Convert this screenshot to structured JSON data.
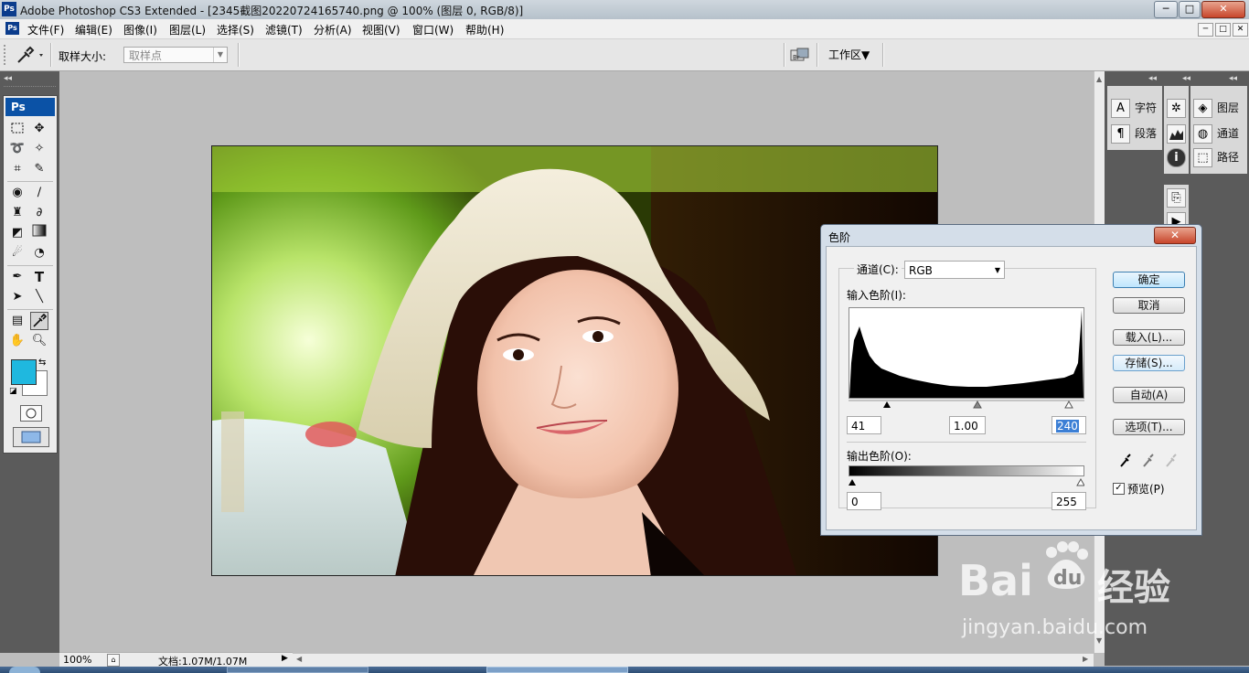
{
  "window": {
    "app_icon": "Ps",
    "title": "Adobe Photoshop CS3 Extended - [2345截图20220724165740.png @ 100% (图层 0, RGB/8)]",
    "controls": [
      "─",
      "□",
      "✕"
    ]
  },
  "menubar": {
    "items": [
      "文件(F)",
      "编辑(E)",
      "图像(I)",
      "图层(L)",
      "选择(S)",
      "滤镜(T)",
      "分析(A)",
      "视图(V)",
      "窗口(W)",
      "帮助(H)"
    ],
    "doc_controls": [
      "─",
      "□",
      "✕"
    ]
  },
  "options_bar": {
    "tool_icon": "eyedropper-icon",
    "sample_size_label": "取样大小:",
    "sample_size_value": "取样点",
    "workspace_label": "工作区▼"
  },
  "toolbox": {
    "header": "Ps",
    "tools": [
      "marquee",
      "move",
      "lasso",
      "magic-wand",
      "crop",
      "slice",
      "healing",
      "brush",
      "stamp",
      "history-brush",
      "eraser",
      "gradient",
      "blur",
      "dodge",
      "pen",
      "type",
      "path-select",
      "line",
      "notes",
      "eyedropper",
      "hand",
      "zoom"
    ],
    "foreground_color": "#1fb8df",
    "background_color": "#ffffff"
  },
  "status_bar": {
    "zoom": "100%",
    "doc_info": "文档:1.07M/1.07M"
  },
  "panels": {
    "group1": [
      {
        "icon": "A",
        "label": "字符"
      },
      {
        "icon": "¶",
        "label": "段落"
      }
    ],
    "group2": [
      {
        "icon": "navigator-icon"
      },
      {
        "icon": "histogram-icon"
      },
      {
        "icon": "info-icon"
      }
    ],
    "group3": [
      {
        "icon": "layers-icon",
        "label": "图层"
      },
      {
        "icon": "channels-icon",
        "label": "通道"
      },
      {
        "icon": "paths-icon",
        "label": "路径"
      }
    ]
  },
  "levels_dialog": {
    "title": "色阶",
    "close": "✕",
    "channel_label": "通道(C):",
    "channel_value": "RGB",
    "input_label": "输入色阶(I):",
    "input_black": "41",
    "input_gamma": "1.00",
    "input_white": "240",
    "output_label": "输出色阶(O):",
    "output_black": "0",
    "output_white": "255",
    "buttons": {
      "ok": "确定",
      "cancel": "取消",
      "load": "载入(L)...",
      "save": "存储(S)...",
      "auto": "自动(A)",
      "options": "选项(T)..."
    },
    "preview_label": "预览(P)",
    "preview_checked": true
  },
  "watermark": {
    "brand": "Bai",
    "paw": "du",
    "cn": "经验",
    "url": "jingyan.baidu.com"
  }
}
